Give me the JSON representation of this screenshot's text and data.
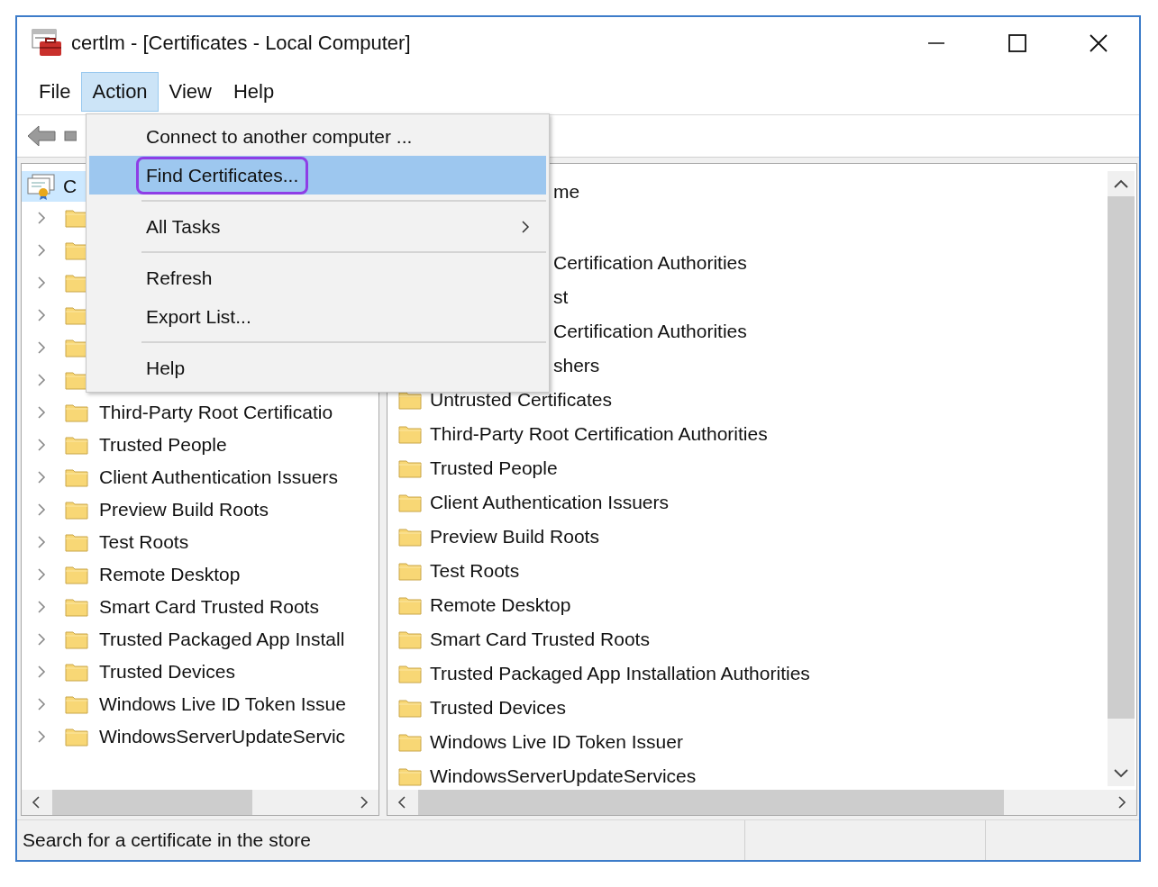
{
  "window": {
    "title": "certlm - [Certificates - Local Computer]"
  },
  "menu_bar": [
    {
      "label": "File",
      "selected": false
    },
    {
      "label": "Action",
      "selected": true
    },
    {
      "label": "View",
      "selected": false
    },
    {
      "label": "Help",
      "selected": false
    }
  ],
  "action_menu": [
    {
      "kind": "item",
      "label": "Connect to another computer ...",
      "selected": false,
      "annotated": false
    },
    {
      "kind": "item",
      "label": "Find Certificates...",
      "selected": true,
      "annotated": true
    },
    {
      "kind": "separator"
    },
    {
      "kind": "submenu",
      "label": "All Tasks",
      "selected": false,
      "annotated": false
    },
    {
      "kind": "separator"
    },
    {
      "kind": "item",
      "label": "Refresh",
      "selected": false,
      "annotated": false
    },
    {
      "kind": "item",
      "label": "Export List...",
      "selected": false,
      "annotated": false
    },
    {
      "kind": "separator"
    },
    {
      "kind": "item",
      "label": "Help",
      "selected": false,
      "annotated": false
    }
  ],
  "tree": {
    "root": {
      "label": "C",
      "selected": true
    },
    "items": [
      {
        "expanded": false
      },
      {
        "expanded": false
      },
      {
        "expanded": false
      },
      {
        "expanded": false
      },
      {
        "expanded": false
      },
      {
        "expanded": false
      },
      {
        "label": "Third-Party Root Certificatio",
        "expanded": false
      },
      {
        "label": "Trusted People",
        "expanded": false
      },
      {
        "label": "Client Authentication Issuers",
        "expanded": false
      },
      {
        "label": "Preview Build Roots",
        "expanded": false
      },
      {
        "label": "Test Roots",
        "expanded": false
      },
      {
        "label": "Remote Desktop",
        "expanded": false
      },
      {
        "label": "Smart Card Trusted Roots",
        "expanded": false
      },
      {
        "label": "Trusted Packaged App Install",
        "expanded": false
      },
      {
        "label": "Trusted Devices",
        "expanded": false
      },
      {
        "label": "Windows Live ID Token Issue",
        "expanded": false
      },
      {
        "label": "WindowsServerUpdateServic",
        "expanded": false
      }
    ]
  },
  "list": {
    "column_header": "me",
    "rows": [
      {
        "kind": "partial",
        "label": "Certification Authorities"
      },
      {
        "kind": "partial",
        "label": "st"
      },
      {
        "kind": "partial",
        "label": "Certification Authorities"
      },
      {
        "kind": "partial",
        "label": "shers"
      },
      {
        "kind": "folder",
        "label": "Untrusted Certificates"
      },
      {
        "kind": "folder",
        "label": "Third-Party Root Certification Authorities"
      },
      {
        "kind": "folder",
        "label": "Trusted People"
      },
      {
        "kind": "folder",
        "label": "Client Authentication Issuers"
      },
      {
        "kind": "folder",
        "label": "Preview Build Roots"
      },
      {
        "kind": "folder",
        "label": "Test Roots"
      },
      {
        "kind": "folder",
        "label": "Remote Desktop"
      },
      {
        "kind": "folder",
        "label": "Smart Card Trusted Roots"
      },
      {
        "kind": "folder",
        "label": "Trusted Packaged App Installation Authorities"
      },
      {
        "kind": "folder",
        "label": "Trusted Devices"
      },
      {
        "kind": "folder",
        "label": "Windows Live ID Token Issuer"
      },
      {
        "kind": "folder",
        "label": "WindowsServerUpdateServices"
      }
    ]
  },
  "status_bar": {
    "text": "Search for a certificate in the store"
  }
}
